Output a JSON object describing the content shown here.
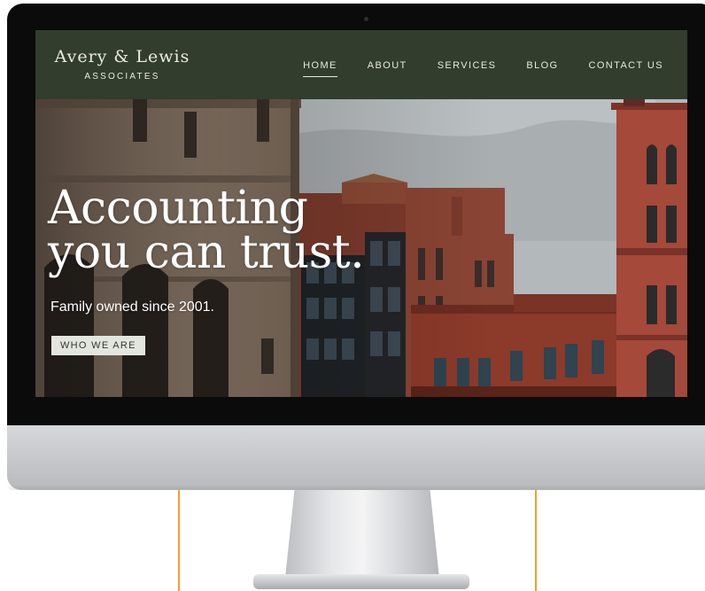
{
  "site": {
    "logo": {
      "name": "Avery & Lewis",
      "subtitle": "ASSOCIATES"
    },
    "nav": [
      {
        "label": "HOME",
        "active": true
      },
      {
        "label": "ABOUT",
        "active": false
      },
      {
        "label": "SERVICES",
        "active": false
      },
      {
        "label": "BLOG",
        "active": false
      },
      {
        "label": "CONTACT US",
        "active": false
      }
    ],
    "hero": {
      "title_line1": "Accounting",
      "title_line2": "you can trust.",
      "tagline": "Family owned since 2001.",
      "cta_label": "WHO WE ARE"
    }
  },
  "colors": {
    "header_bg": "#323d2e",
    "accent_guide": "#f2a130",
    "cta_bg": "#e3e6df"
  }
}
